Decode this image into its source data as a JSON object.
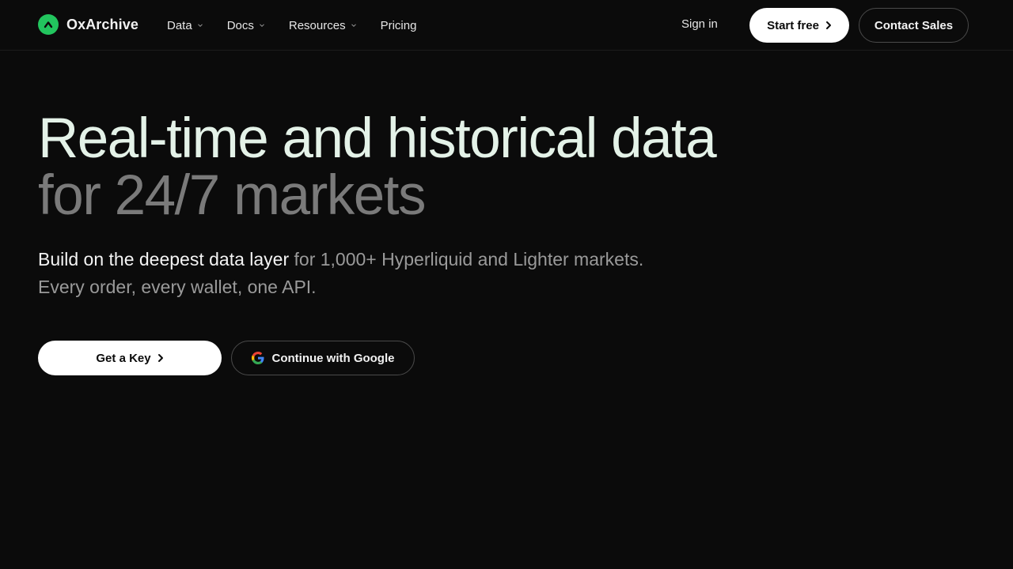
{
  "brand": {
    "name": "OxArchive",
    "accent_color": "#22c55e",
    "logo_icon": "caret-up-icon"
  },
  "nav": {
    "items": [
      {
        "label": "Data",
        "has_dropdown": true
      },
      {
        "label": "Docs",
        "has_dropdown": true
      },
      {
        "label": "Resources",
        "has_dropdown": true
      },
      {
        "label": "Pricing",
        "has_dropdown": false
      }
    ],
    "sign_in": "Sign in",
    "start_free": "Start free",
    "contact_sales": "Contact Sales"
  },
  "hero": {
    "title_line1": "Real-time and historical data",
    "title_line2": "for 24/7 markets",
    "subtitle_strong": "Build on the deepest data layer",
    "subtitle_rest": " for 1,000+ Hyperliquid and Lighter markets.",
    "subtitle_line2": "Every order, every wallet, one API.",
    "primary_cta": "Get a Key",
    "secondary_cta": "Continue with Google"
  }
}
